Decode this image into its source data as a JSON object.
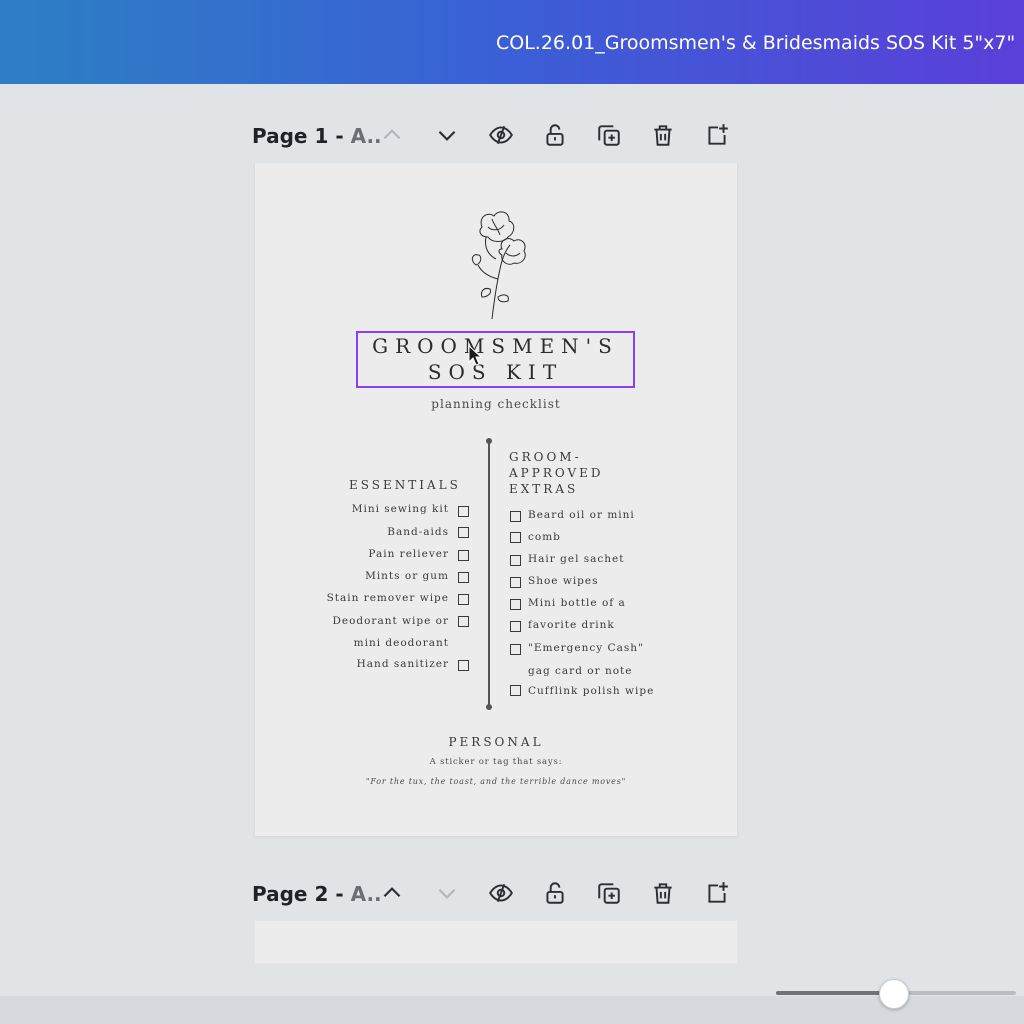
{
  "app": {
    "doc_title": "COL.26.01_Groomsmen's & Bridesmaids SOS Kit 5\"x7\"",
    "zoom_fraction": 0.49
  },
  "pages": [
    {
      "label": "Page 1 -",
      "label_sub": "A.."
    },
    {
      "label": "Page 2 -",
      "label_sub": "A.."
    }
  ],
  "toolbar_icons": [
    "chevron-up-icon",
    "chevron-down-icon",
    "eye-hide-icon",
    "lock-icon",
    "duplicate-icon",
    "trash-icon",
    "add-page-icon"
  ],
  "design": {
    "title_line1": "GROOMSMEN'S",
    "title_line2": "SOS KIT",
    "subtitle": "planning checklist",
    "essentials_heading": "ESSENTIALS",
    "essentials": [
      "Mini sewing kit",
      "Band-aids",
      "Pain reliever",
      "Mints or gum",
      "Stain remover wipe",
      "Deodorant wipe or",
      "mini deodorant",
      "Hand sanitizer"
    ],
    "extras_heading_1": "GROOM-",
    "extras_heading_2": "APPROVED",
    "extras_heading_3": "EXTRAS",
    "extras": [
      "Beard oil or mini",
      "comb",
      "Hair gel sachet",
      "Shoe wipes",
      "Mini bottle of a",
      "favorite drink",
      "\"Emergency Cash\"",
      "gag card or note",
      "Cufflink polish wipe"
    ],
    "personal_heading": "PERSONAL",
    "personal_line1": "A sticker or tag that says:",
    "personal_line2": "\"For the tux, the toast, and the terrible dance moves\""
  },
  "colors": {
    "topbar_start": "#2d7fc4",
    "topbar_end": "#5a3fd8",
    "selection": "#8a3ffc"
  }
}
